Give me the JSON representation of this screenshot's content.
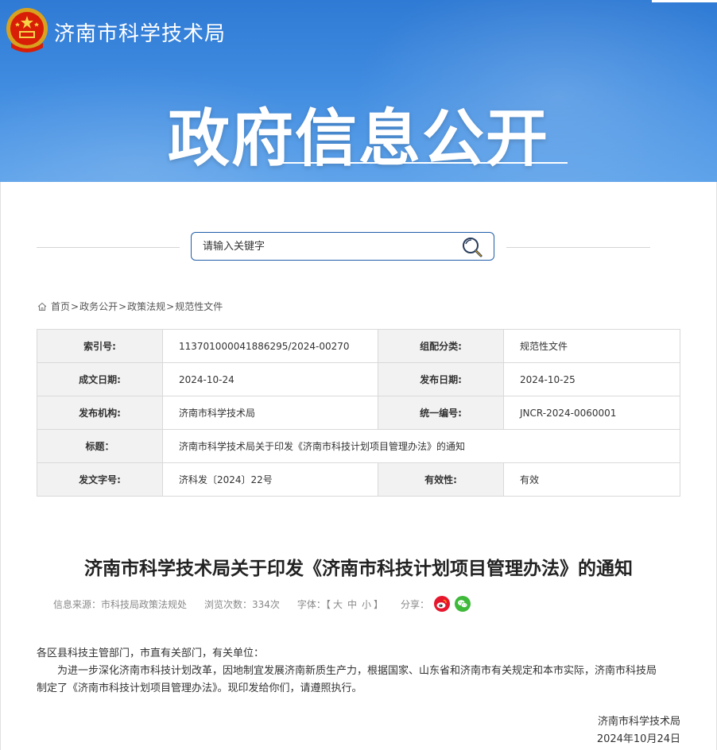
{
  "header": {
    "site_name": "济南市科学技术局",
    "banner_title": "政府信息公开"
  },
  "search": {
    "placeholder": "请输入关键字"
  },
  "breadcrumb": {
    "items": [
      "首页",
      "政务公开",
      "政策法规",
      "规范性文件"
    ],
    "separator": ">"
  },
  "info_table": {
    "rows": [
      {
        "k1": "索引号:",
        "v1": "113701000041886295/2024-00270",
        "k2": "组配分类:",
        "v2": "规范性文件"
      },
      {
        "k1": "成文日期:",
        "v1": "2024-10-24",
        "k2": "发布日期:",
        "v2": "2024-10-25"
      },
      {
        "k1": "发布机构:",
        "v1": "济南市科学技术局",
        "k2": "统一编号:",
        "v2": "JNCR-2024-0060001"
      }
    ],
    "title_row": {
      "k": "标题：",
      "v": "济南市科学技术局关于印发《济南市科技计划项目管理办法》的通知"
    },
    "last_row": {
      "k1": "发文字号:",
      "v1": "济科发〔2024〕22号",
      "k2": "有效性:",
      "v2": "有效"
    }
  },
  "article": {
    "title": "济南市科学技术局关于印发《济南市科技计划项目管理办法》的通知",
    "meta": {
      "source": "信息来源：市科技局政策法规处",
      "views": "浏览次数：334次",
      "font_label": "字体：【",
      "font_large": "大",
      "font_medium": "中",
      "font_small": "小",
      "font_close": "】",
      "share_label": "分享："
    },
    "salutation": "各区县科技主管部门，市直有关部门，有关单位：",
    "paragraph_line1": "为进一步深化济南市科技计划改革，因地制宜发展济南新质生产力，根据国家、山东省和济南市有关规定和本市实际，济南市科技局",
    "paragraph_line2": "制定了《济南市科技计划项目管理办法》。现印发给你们，请遵照执行。",
    "signature": "济南市科学技术局",
    "date": "2024年10月24日"
  },
  "colors": {
    "header_blue": "#3f8be0",
    "search_border": "#1f5ea8",
    "weibo_red": "#e6162d",
    "wechat_green": "#3fb93a"
  },
  "icons": [
    "national-emblem-icon",
    "search-icon",
    "home-icon",
    "weibo-icon",
    "wechat-icon"
  ]
}
